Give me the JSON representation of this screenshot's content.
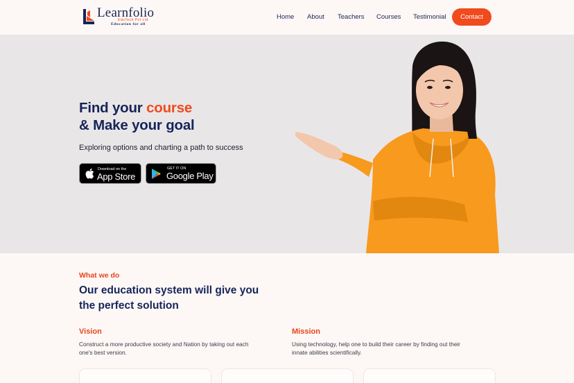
{
  "brand": {
    "name": "Learnfolio",
    "company": "EduTech Pvt Ltd",
    "tagline": "Education for all",
    "colors": {
      "primary": "#16245a",
      "accent": "#f04a1d"
    }
  },
  "nav": {
    "items": [
      "Home",
      "About",
      "Teachers",
      "Courses",
      "Testimonial"
    ],
    "contact_label": "Contact"
  },
  "hero": {
    "headline_part1": "Find your ",
    "headline_accent": "course",
    "headline_line2": "& Make your goal",
    "subtitle": "Exploring options and charting a path to success",
    "app_store": {
      "small": "Download on the",
      "big": "App Store",
      "icon": "apple-icon"
    },
    "google_play": {
      "small": "GET IT ON",
      "big": "Google Play",
      "icon": "google-play-icon"
    }
  },
  "what_we_do": {
    "eyebrow": "What we do",
    "heading_line1": "Our education system will give you",
    "heading_line2": "the perfect solution",
    "vision": {
      "title": "Vision",
      "line1": "Construct a more productive society and Nation by taking out each",
      "line2": "one's best version."
    },
    "mission": {
      "title": "Mission",
      "line1": "Using technology, help one to build their career by finding out their",
      "line2": "innate abilities scientifically."
    }
  }
}
